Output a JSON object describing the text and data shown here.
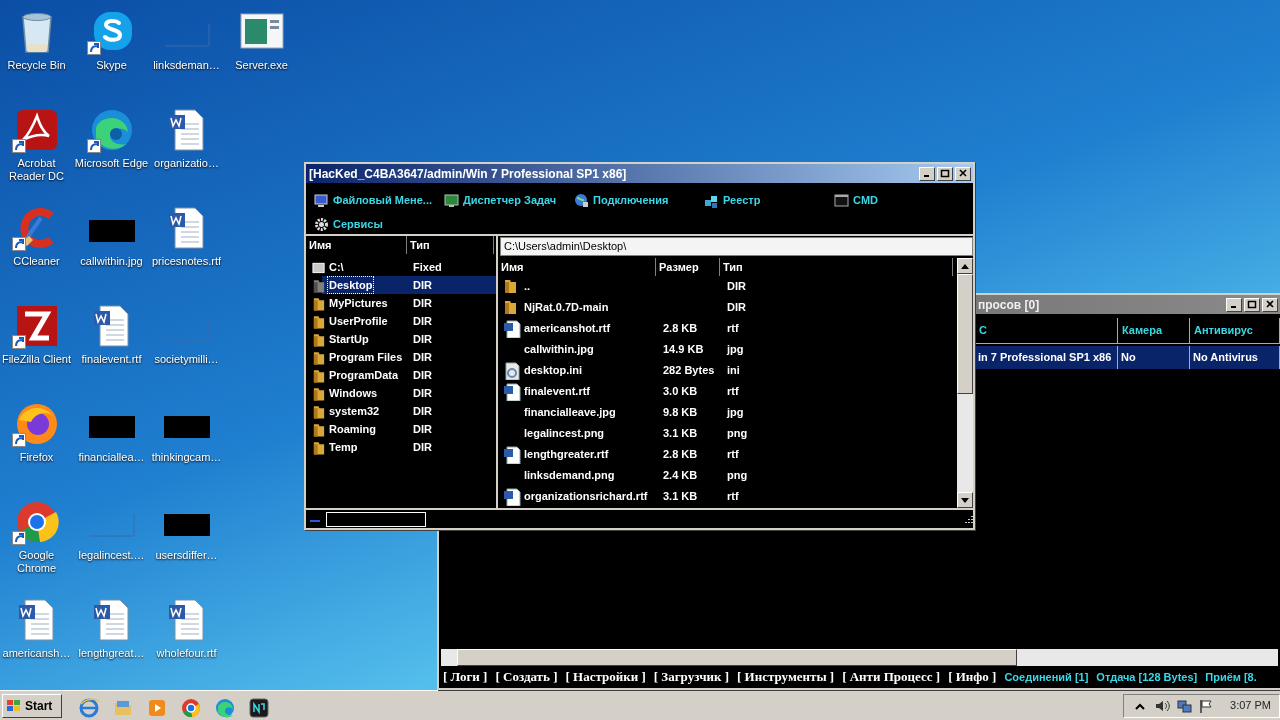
{
  "desktop": {
    "rows": [
      {
        "icons": [
          {
            "label": "Recycle Bin",
            "kind": "recycle",
            "shortcut": false
          },
          {
            "label": "Skype",
            "kind": "skype",
            "shortcut": true
          },
          {
            "label": "linksdeman…",
            "kind": "thumb-light",
            "shortcut": false
          },
          {
            "label": "Server.exe",
            "kind": "exe",
            "shortcut": false
          }
        ]
      },
      {
        "icons": [
          {
            "label": "Acrobat Reader DC",
            "kind": "acrobat",
            "shortcut": true
          },
          {
            "label": "Microsoft Edge",
            "kind": "edge",
            "shortcut": true
          },
          {
            "label": "organizatio…",
            "kind": "word",
            "shortcut": false
          }
        ]
      },
      {
        "icons": [
          {
            "label": "CCleaner",
            "kind": "ccleaner",
            "shortcut": true
          },
          {
            "label": "callwithin.jpg",
            "kind": "thumb-dark",
            "shortcut": false
          },
          {
            "label": "pricesnotes.rtf",
            "kind": "word",
            "shortcut": false
          }
        ]
      },
      {
        "icons": [
          {
            "label": "FileZilla Client",
            "kind": "filezilla",
            "shortcut": true
          },
          {
            "label": "finalevent.rtf",
            "kind": "word",
            "shortcut": false
          },
          {
            "label": "societymilli…",
            "kind": "thumb-light",
            "shortcut": false
          }
        ]
      },
      {
        "icons": [
          {
            "label": "Firefox",
            "kind": "firefox",
            "shortcut": true
          },
          {
            "label": "financiallea…",
            "kind": "thumb-dark",
            "shortcut": false
          },
          {
            "label": "thinkingcam…",
            "kind": "thumb-dark",
            "shortcut": false
          }
        ]
      },
      {
        "icons": [
          {
            "label": "Google Chrome",
            "kind": "chrome",
            "shortcut": true
          },
          {
            "label": "legalincest.…",
            "kind": "thumb-light",
            "shortcut": false
          },
          {
            "label": "usersdiffer…",
            "kind": "thumb-dark",
            "shortcut": false
          }
        ]
      },
      {
        "icons": [
          {
            "label": "americansh…",
            "kind": "word",
            "shortcut": false
          },
          {
            "label": "lengthgreat…",
            "kind": "word",
            "shortcut": false
          },
          {
            "label": "wholefour.rtf",
            "kind": "word",
            "shortcut": false
          }
        ]
      }
    ]
  },
  "back_window": {
    "title": "просов [0]",
    "columns": [
      "С",
      "Камера",
      "Антивирус"
    ],
    "rows": [
      {
        "cells": [
          "in 7 Professional SP1 x86",
          "No",
          "No Antivirus"
        ],
        "selected": true
      }
    ],
    "menu": [
      "[ Логи ]",
      "[ Создать ]",
      "[ Настройки ]",
      "[ Загрузчик ]",
      "[ Инструменты ]",
      "[ Анти Процесс ]",
      "[ Инфо ]"
    ],
    "status": [
      "Соединений [1]",
      "Отдача [128 Bytes]",
      "Приём [8."
    ]
  },
  "file_window": {
    "title": "[HacKed_C4BA3647/admin/Win 7 Professional SP1 x86]",
    "toolbar": [
      {
        "label": "Файловый Мене...",
        "kind": "files"
      },
      {
        "label": "Диспетчер Задач",
        "kind": "tasks"
      },
      {
        "label": "Подключения",
        "kind": "connections"
      },
      {
        "label": "Реестр",
        "kind": "registry"
      },
      {
        "label": "CMD",
        "kind": "cmd"
      },
      {
        "label": "Сервисы",
        "kind": "services"
      }
    ],
    "tree": {
      "columns": [
        "Имя",
        "Тип"
      ],
      "rows": [
        {
          "name": "C:\\",
          "type": "Fixed",
          "kind": "drive",
          "selected": false
        },
        {
          "name": "Desktop",
          "type": "DIR",
          "kind": "folder-dark",
          "selected": true
        },
        {
          "name": "MyPictures",
          "type": "DIR",
          "kind": "folder",
          "selected": false
        },
        {
          "name": "UserProfile",
          "type": "DIR",
          "kind": "folder",
          "selected": false
        },
        {
          "name": "StartUp",
          "type": "DIR",
          "kind": "folder",
          "selected": false
        },
        {
          "name": "Program Files",
          "type": "DIR",
          "kind": "folder",
          "selected": false
        },
        {
          "name": "ProgramData",
          "type": "DIR",
          "kind": "folder",
          "selected": false
        },
        {
          "name": "Windows",
          "type": "DIR",
          "kind": "folder",
          "selected": false
        },
        {
          "name": "system32",
          "type": "DIR",
          "kind": "folder",
          "selected": false
        },
        {
          "name": "Roaming",
          "type": "DIR",
          "kind": "folder",
          "selected": false
        },
        {
          "name": "Temp",
          "type": "DIR",
          "kind": "folder",
          "selected": false
        }
      ]
    },
    "path": "C:\\Users\\admin\\Desktop\\",
    "files": {
      "columns": [
        "Имя",
        "Размер",
        "Тип"
      ],
      "rows": [
        {
          "name": "..",
          "type": "DIR",
          "kind": "folder"
        },
        {
          "name": "NjRat.0.7D-main",
          "type": "DIR",
          "kind": "folder"
        },
        {
          "name": "americanshot.rtf",
          "size": "2.8 KB",
          "type": "rtf",
          "kind": "word"
        },
        {
          "name": "callwithin.jpg",
          "size": "14.9 KB",
          "type": "jpg",
          "kind": "plain"
        },
        {
          "name": "desktop.ini",
          "size": "282 Bytes",
          "type": "ini",
          "kind": "ini"
        },
        {
          "name": "finalevent.rtf",
          "size": "3.0 KB",
          "type": "rtf",
          "kind": "word"
        },
        {
          "name": "financialleave.jpg",
          "size": "9.8 KB",
          "type": "jpg",
          "kind": "plain"
        },
        {
          "name": "legalincest.png",
          "size": "3.1 KB",
          "type": "png",
          "kind": "plain"
        },
        {
          "name": "lengthgreater.rtf",
          "size": "2.8 KB",
          "type": "rtf",
          "kind": "word"
        },
        {
          "name": "linksdemand.png",
          "size": "2.4 KB",
          "type": "png",
          "kind": "plain"
        },
        {
          "name": "organizationsrichard.rtf",
          "size": "3.1 KB",
          "type": "rtf",
          "kind": "word"
        }
      ]
    }
  },
  "taskbar": {
    "start": "Start",
    "apps": [
      {
        "kind": "ie"
      },
      {
        "kind": "explorer"
      },
      {
        "kind": "media"
      },
      {
        "kind": "chrome"
      },
      {
        "kind": "edge"
      },
      {
        "kind": "njrat"
      }
    ],
    "tray": [
      {
        "kind": "chevron"
      },
      {
        "kind": "speaker"
      },
      {
        "kind": "network"
      },
      {
        "kind": "flag"
      }
    ],
    "time": "3:07 PM"
  }
}
